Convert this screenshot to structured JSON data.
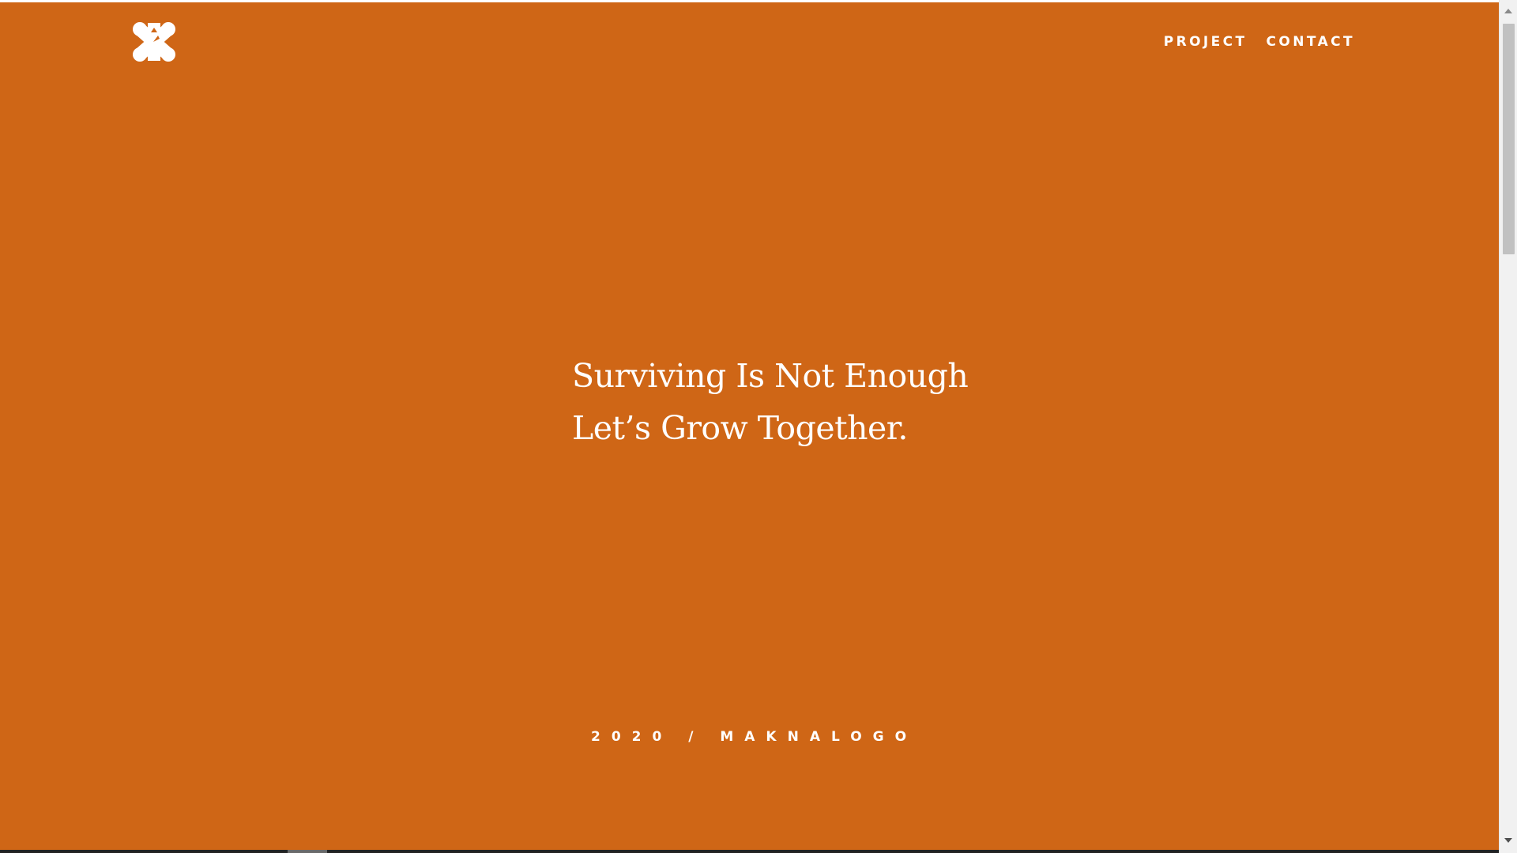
{
  "brand": {
    "logo_icon": "mx-monogram-logo"
  },
  "nav": {
    "items": [
      {
        "label": "PROJECT"
      },
      {
        "label": "CONTACT"
      }
    ]
  },
  "hero": {
    "line1": "Surviving Is Not Enough",
    "line2": "Let’s Grow Together."
  },
  "footer": {
    "tag": "2020 / MAKNALOGO"
  },
  "colors": {
    "background": "#cf6616",
    "text": "#ffffff",
    "scrollbar_track": "#f1f1f1",
    "scrollbar_thumb": "#c1c1c1"
  },
  "scrollbar": {
    "position_fraction": 0.0
  }
}
